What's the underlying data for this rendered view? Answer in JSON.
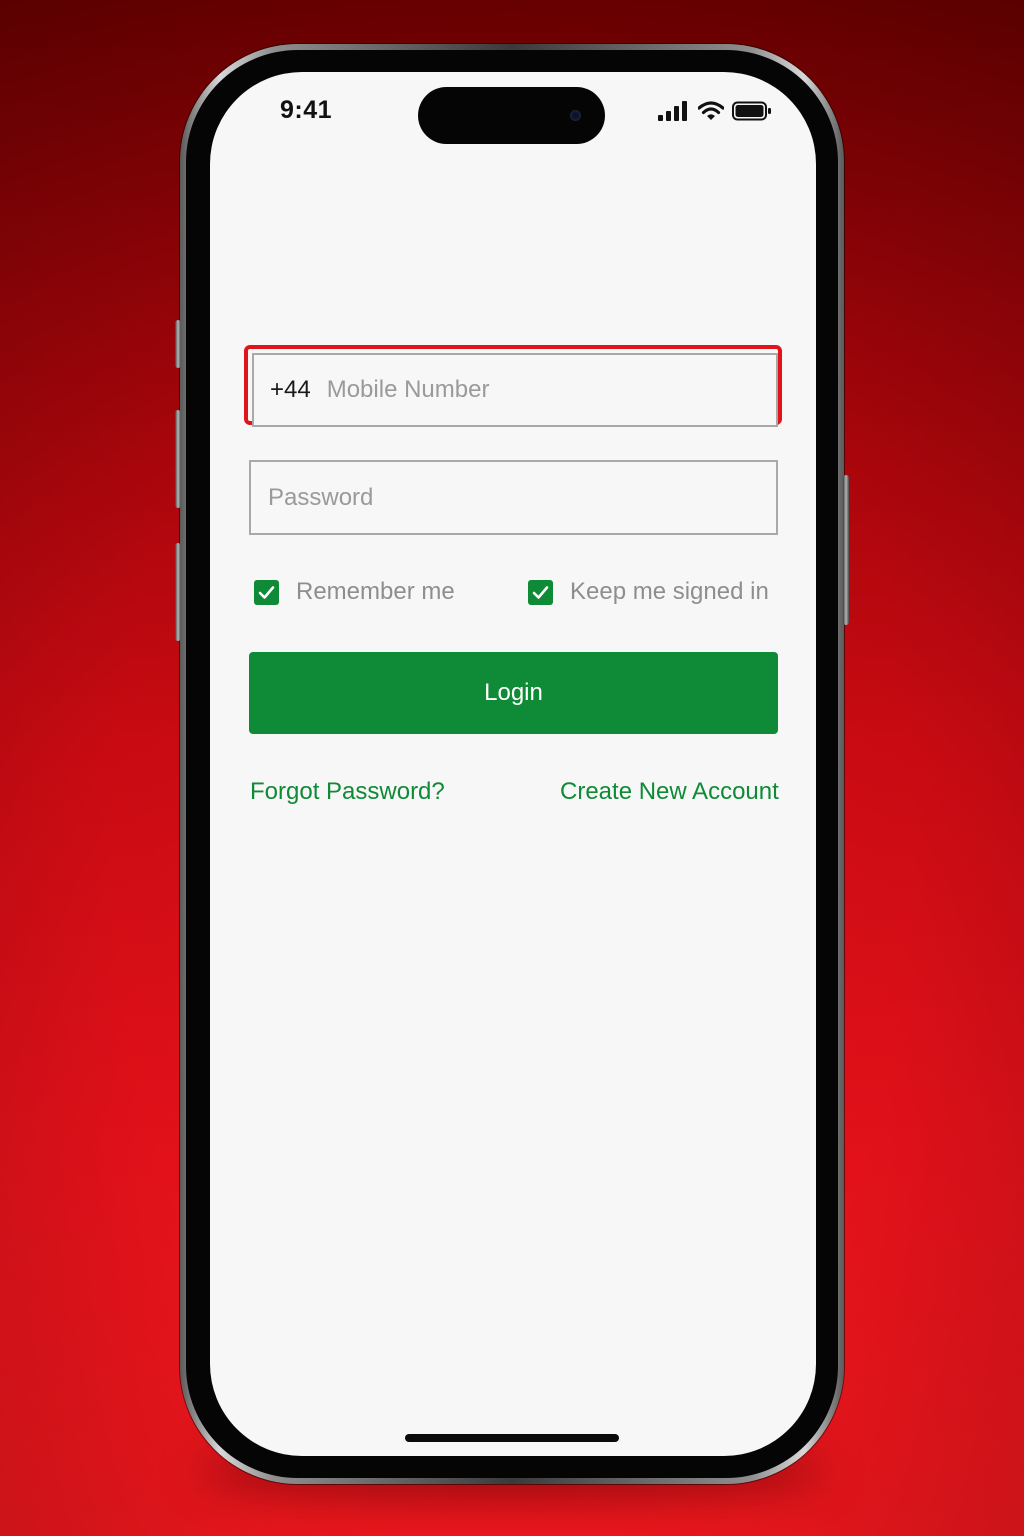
{
  "status_bar": {
    "time": "9:41",
    "signal_icon": "cellular-signal-icon",
    "wifi_icon": "wifi-icon",
    "battery_icon": "battery-icon"
  },
  "login_form": {
    "mobile": {
      "country_code": "+44",
      "value": "",
      "placeholder": "Mobile Number"
    },
    "password": {
      "value": "",
      "placeholder": "Password"
    },
    "remember_me": {
      "label": "Remember me",
      "checked": true
    },
    "keep_signed_in": {
      "label": "Keep me signed in",
      "checked": true
    },
    "login_label": "Login",
    "forgot_password_label": "Forgot Password?",
    "create_account_label": "Create New Account"
  },
  "colors": {
    "accent_green": "#0f8a36",
    "error_red": "#e0141b",
    "background_red": "#c80a12"
  }
}
